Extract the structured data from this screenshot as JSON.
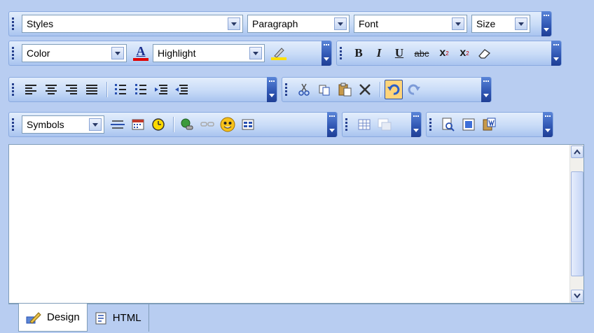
{
  "toolbars": {
    "styles_combo": "Styles",
    "paragraph_combo": "Paragraph",
    "font_combo": "Font",
    "size_combo": "Size",
    "color_combo": "Color",
    "highlight_combo": "Highlight",
    "symbols_combo": "Symbols",
    "font_color_glyph": "A",
    "bold_glyph": "B",
    "italic_glyph": "I",
    "underline_glyph": "U",
    "strike_glyph": "abc",
    "superscript_glyph": "x",
    "subscript_glyph": "x",
    "superscript_mark": "2",
    "subscript_mark": "2"
  },
  "mode_tabs": {
    "design_label": "Design",
    "html_label": "HTML"
  },
  "colors": {
    "font_color_bar": "#e00000",
    "highlight_bar": "#ffe000",
    "active_button": "#ffd47a"
  },
  "icons": [
    "grip-icon",
    "font-color-icon",
    "highlight-pen-icon",
    "bold-icon",
    "italic-icon",
    "underline-icon",
    "strikethrough-icon",
    "superscript-icon",
    "subscript-icon",
    "eraser-icon",
    "align-left-icon",
    "align-center-icon",
    "align-right-icon",
    "justify-icon",
    "bullet-list-icon",
    "numbered-list-icon",
    "indent-icon",
    "outdent-icon",
    "cut-icon",
    "copy-icon",
    "paste-icon",
    "delete-icon",
    "undo-icon",
    "redo-icon",
    "horizontal-rule-icon",
    "calendar-icon",
    "clock-icon",
    "hyperlink-icon",
    "unlink-icon",
    "smiley-icon",
    "form-icon",
    "table-icon",
    "table-properties-icon",
    "preview-icon",
    "select-all-icon",
    "word-paste-icon",
    "design-icon",
    "html-icon"
  ]
}
